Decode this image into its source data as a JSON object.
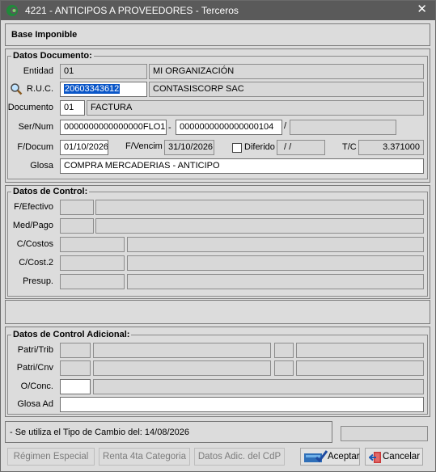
{
  "window": {
    "title": "4221 - ANTICIPOS A PROVEEDORES - Terceros",
    "close": "✕"
  },
  "header": {
    "title": "Base Imponible"
  },
  "doc": {
    "section": "Datos Documento:",
    "entidad_label": "Entidad",
    "entidad_code": "01",
    "entidad_name": "MI ORGANIZACIÓN",
    "ruc_label": "R.U.C.",
    "ruc_value": "20603343612",
    "ruc_name": "CONTASISCORP SAC",
    "documento_label": "Documento",
    "documento_code": "01",
    "documento_name": "FACTURA",
    "sernum_label": "Ser/Num",
    "serie": "0000000000000000FLO1",
    "dash": "-",
    "numero": "0000000000000000104",
    "slash": "/",
    "fdocum_label": "F/Docum",
    "fdocum_value": "01/10/2026",
    "fvencim_label": "F/Vencim",
    "fvencim_value": "31/10/2026",
    "diferido_label": "Diferido",
    "diferido_value": "/ /",
    "tc_label": "T/C",
    "tc_value": "3.371000",
    "glosa_label": "Glosa",
    "glosa_value": "COMPRA MERCADERIAS - ANTICIPO"
  },
  "control": {
    "section": "Datos de Control:",
    "fefectivo": "F/Efectivo",
    "medpago": "Med/Pago",
    "ccostos": "C/Costos",
    "ccost2": "C/Cost.2",
    "presup": "Presup."
  },
  "adicional": {
    "section": "Datos de Control Adicional:",
    "patritrib": "Patri/Trib",
    "patricnv": "Patri/Cnv",
    "oconc": "O/Conc.",
    "glosaad": "Glosa Ad"
  },
  "status": {
    "message": "- Se utiliza el Tipo de Cambio del: 14/08/2026"
  },
  "buttons": {
    "regimen": "Régimen Especial",
    "renta": "Renta 4ta Categoria",
    "datos_adic": "Datos Adic. del CdP",
    "aceptar": "Aceptar",
    "cancelar": "Cancelar"
  }
}
